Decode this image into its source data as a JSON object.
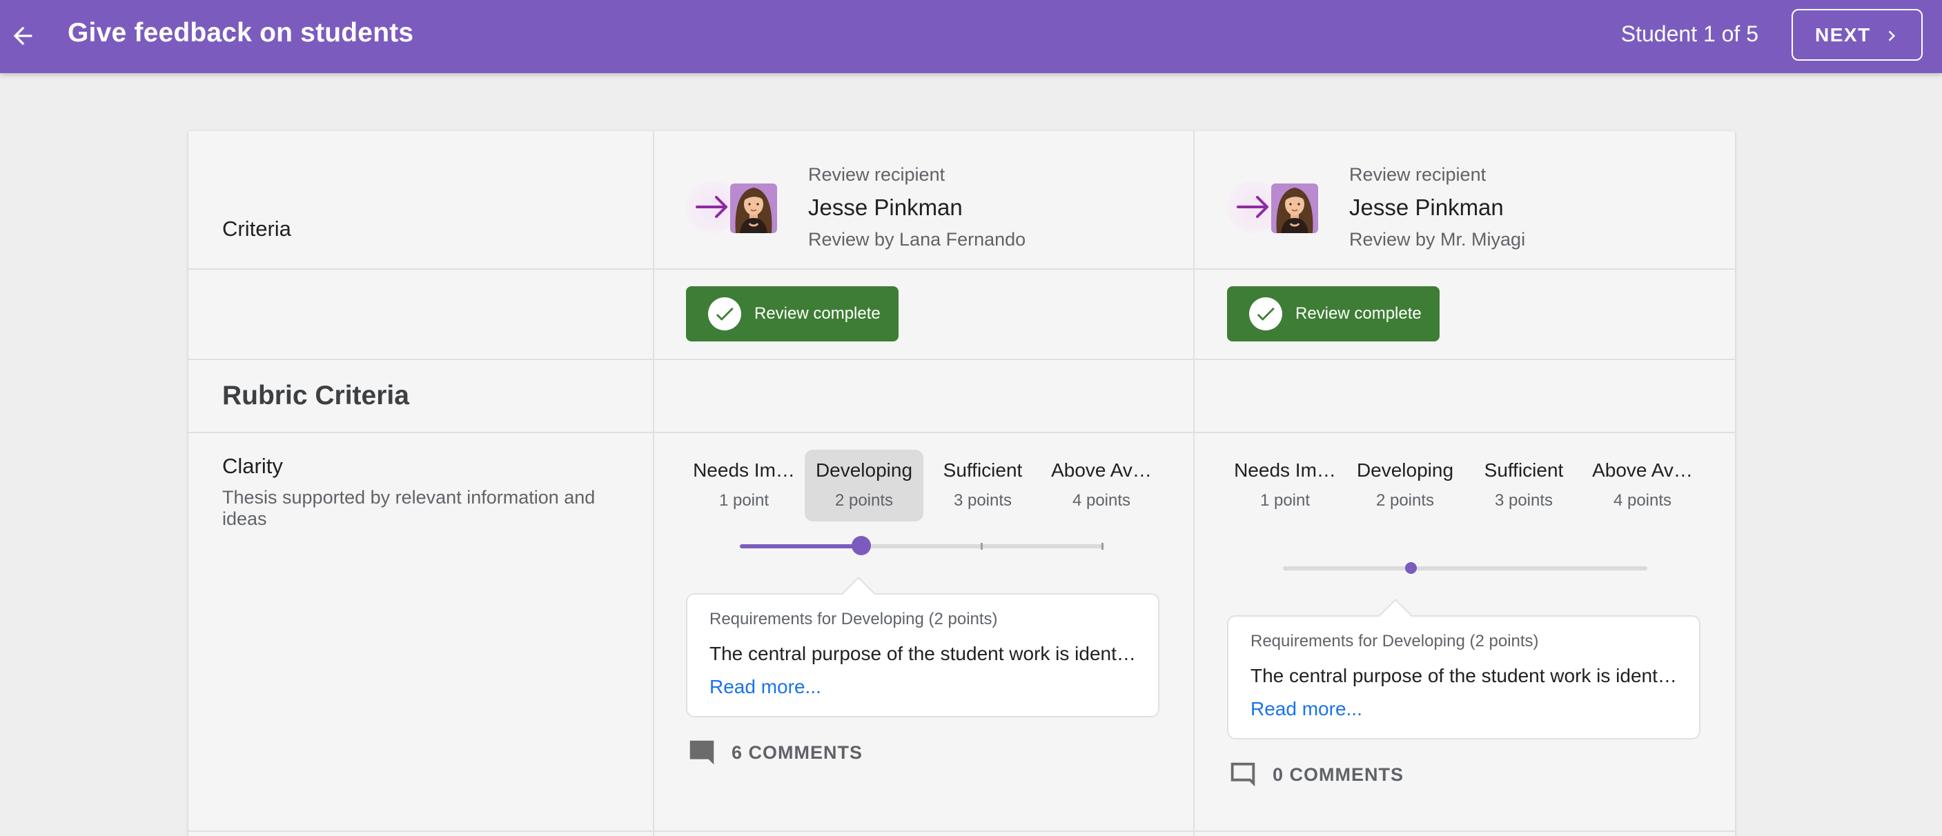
{
  "header": {
    "title": "Give feedback on students",
    "counter": "Student 1 of 5",
    "next_label": "NEXT",
    "color": "#7b5cbe"
  },
  "table": {
    "criteria_header": "Criteria",
    "section_title": "Rubric Criteria",
    "criterion": {
      "name": "Clarity",
      "description": "Thesis supported by relevant information and ideas"
    },
    "levels": [
      {
        "name": "Needs Im…",
        "points": "1 point"
      },
      {
        "name": "Developing",
        "points": "2 points"
      },
      {
        "name": "Sufficient",
        "points": "3 points"
      },
      {
        "name": "Above Av…",
        "points": "4 points"
      }
    ]
  },
  "reviews": [
    {
      "recipient_label": "Review recipient",
      "recipient_name": "Jesse Pinkman",
      "reviewer": "Review by Lana Fernando",
      "status": "Review complete",
      "selected_level": 2,
      "popover_title": "Requirements for Developing (2 points)",
      "popover_body": "The central purpose of the student work is identified and maintained throughout",
      "read_more": "Read more...",
      "comments": "6 COMMENTS"
    },
    {
      "recipient_label": "Review recipient",
      "recipient_name": "Jesse Pinkman",
      "reviewer": "Review by Mr. Miyagi",
      "status": "Review complete",
      "selected_level": 2,
      "popover_title": "Requirements for Developing (2 points)",
      "popover_body": "The central purpose of the student work is identified and maintained throughout",
      "read_more": "Read more...",
      "comments": "0 COMMENTS"
    }
  ],
  "colors": {
    "accent": "#7b5cbe",
    "success": "#3e7d35",
    "link": "#1a73e8"
  },
  "icons": [
    "arrow-back-icon",
    "chevron-right-icon",
    "arrow-right-icon",
    "check-icon",
    "comment-filled-icon",
    "comment-outline-icon"
  ]
}
